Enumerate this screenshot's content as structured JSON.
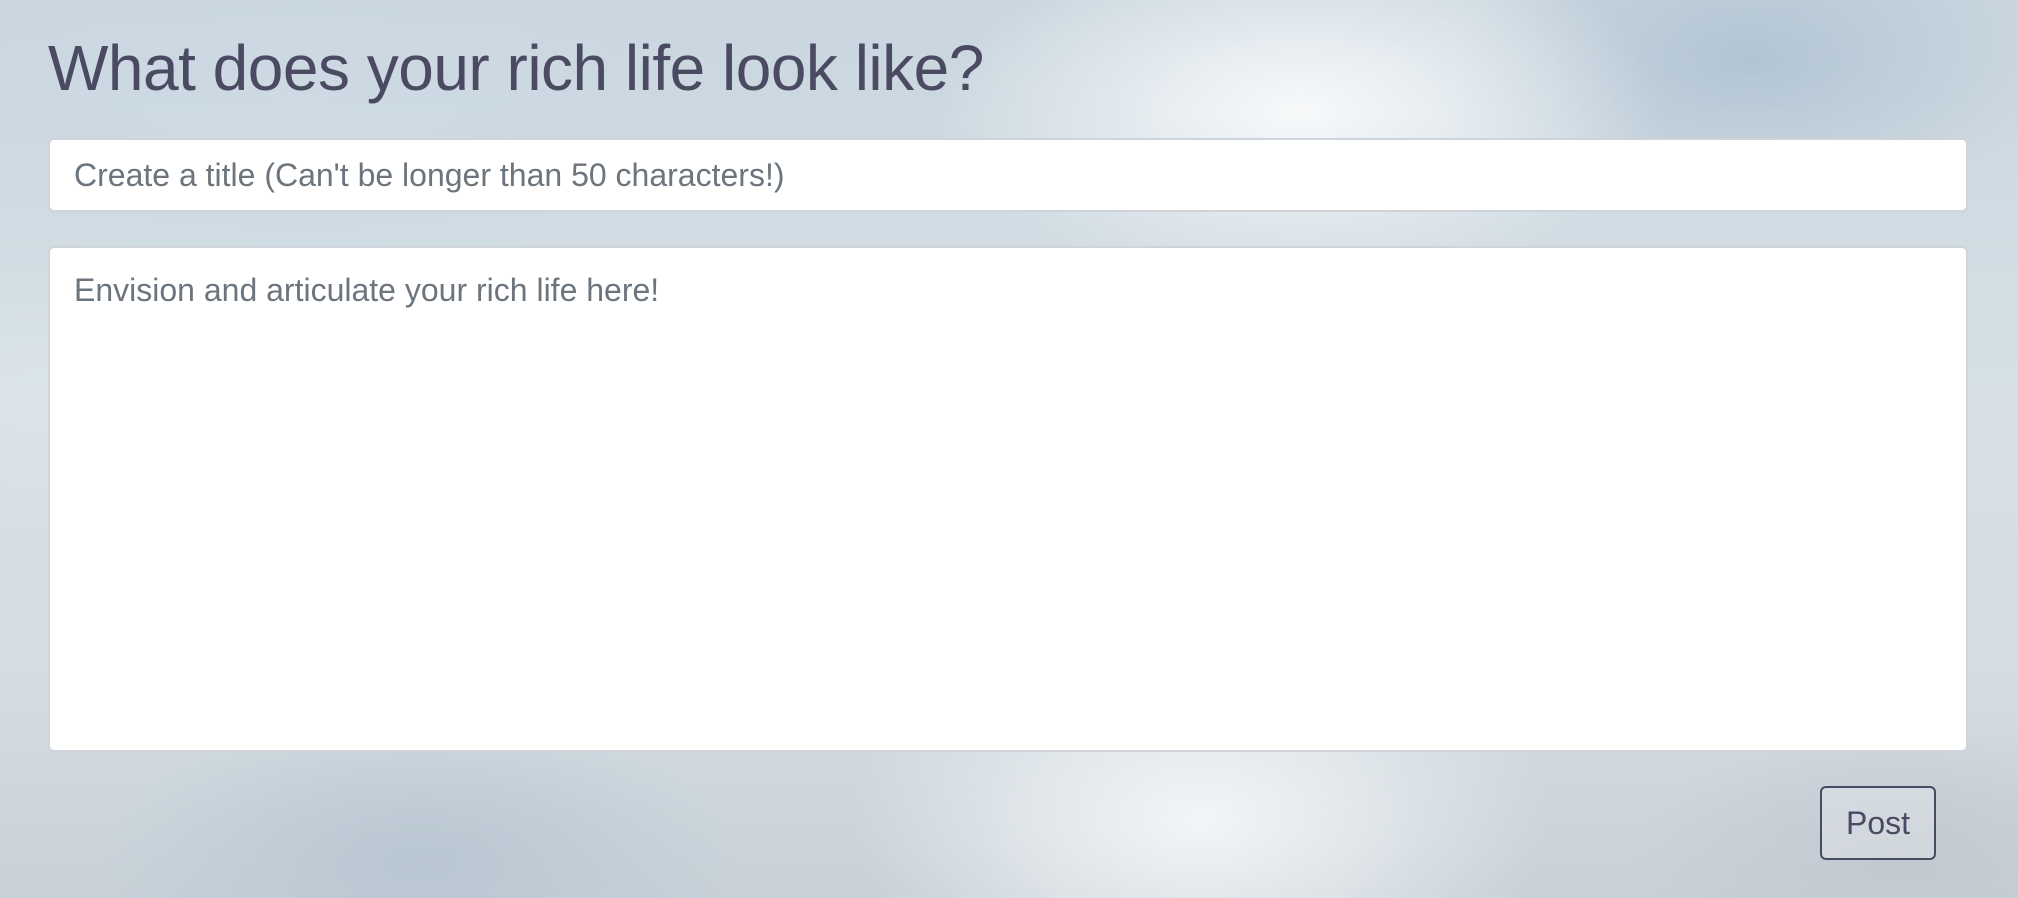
{
  "header": {
    "title": "What does your rich life look like?"
  },
  "form": {
    "title_input": {
      "value": "",
      "placeholder": "Create a title (Can't be longer than 50 characters!)"
    },
    "body_textarea": {
      "value": "",
      "placeholder": "Envision and articulate your rich life here!"
    },
    "post_button_label": "Post"
  },
  "colors": {
    "heading": "#4a4a63",
    "placeholder": "#6c757d",
    "input_border": "#ced4da",
    "button_border": "#4a4a63"
  }
}
